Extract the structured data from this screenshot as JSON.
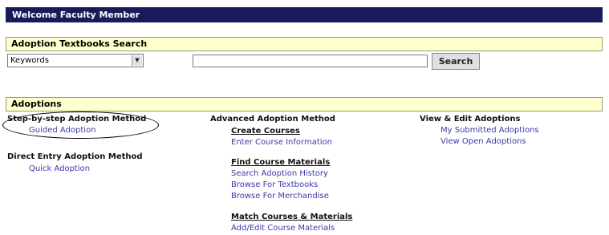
{
  "welcome": {
    "title": "Welcome Faculty Member"
  },
  "search": {
    "section_title": "Adoption Textbooks Search",
    "select_value": "Keywords",
    "input_value": "",
    "button_label": "Search"
  },
  "adoptions": {
    "section_title": "Adoptions",
    "step_by_step": {
      "heading": "Step-by-step Adoption Method",
      "link": "Guided Adoption"
    },
    "direct_entry": {
      "heading": "Direct Entry Adoption Method",
      "link": "Quick Adoption"
    },
    "advanced": {
      "heading": "Advanced Adoption Method",
      "create_courses": {
        "title": "Create Courses",
        "links": [
          "Enter Course Information"
        ]
      },
      "find_materials": {
        "title": "Find Course Materials",
        "links": [
          "Search Adoption History",
          "Browse For Textbooks",
          "Browse For Merchandise"
        ]
      },
      "match": {
        "title": "Match Courses & Materials",
        "links": [
          "Add/Edit Course Materials"
        ]
      }
    },
    "view_edit": {
      "heading": "View & Edit Adoptions",
      "links": [
        "My Submitted Adoptions",
        "View Open Adoptions"
      ]
    }
  }
}
